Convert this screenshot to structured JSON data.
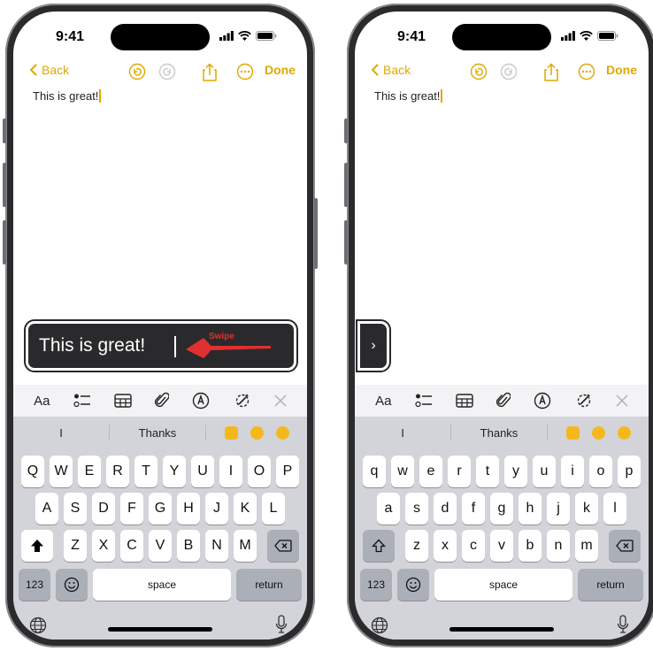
{
  "colors": {
    "accent": "#E0A800",
    "swipe_arrow": "#E03030",
    "dark_bar": "#2A2A2C"
  },
  "status": {
    "time": "9:41"
  },
  "toolbar": {
    "back": "Back",
    "done": "Done"
  },
  "note": {
    "text": "This is great!"
  },
  "format_bar": {
    "text_style": "Aa"
  },
  "suggestions": [
    "I",
    "Thanks"
  ],
  "keyboard_upper": {
    "row1": [
      "Q",
      "W",
      "E",
      "R",
      "T",
      "Y",
      "U",
      "I",
      "O",
      "P"
    ],
    "row2": [
      "A",
      "S",
      "D",
      "F",
      "G",
      "H",
      "J",
      "K",
      "L"
    ],
    "row3": [
      "Z",
      "X",
      "C",
      "V",
      "B",
      "N",
      "M"
    ]
  },
  "keyboard_lower": {
    "row1": [
      "q",
      "w",
      "e",
      "r",
      "t",
      "y",
      "u",
      "i",
      "o",
      "p"
    ],
    "row2": [
      "a",
      "s",
      "d",
      "f",
      "g",
      "h",
      "j",
      "k",
      "l"
    ],
    "row3": [
      "z",
      "x",
      "c",
      "v",
      "b",
      "n",
      "m"
    ]
  },
  "keys": {
    "numbers": "123",
    "space": "space",
    "return": "return"
  },
  "swipe_overlay": {
    "text": "This is great!",
    "hint": "Swipe"
  },
  "collapsed_tab": {
    "chevron": "›"
  }
}
